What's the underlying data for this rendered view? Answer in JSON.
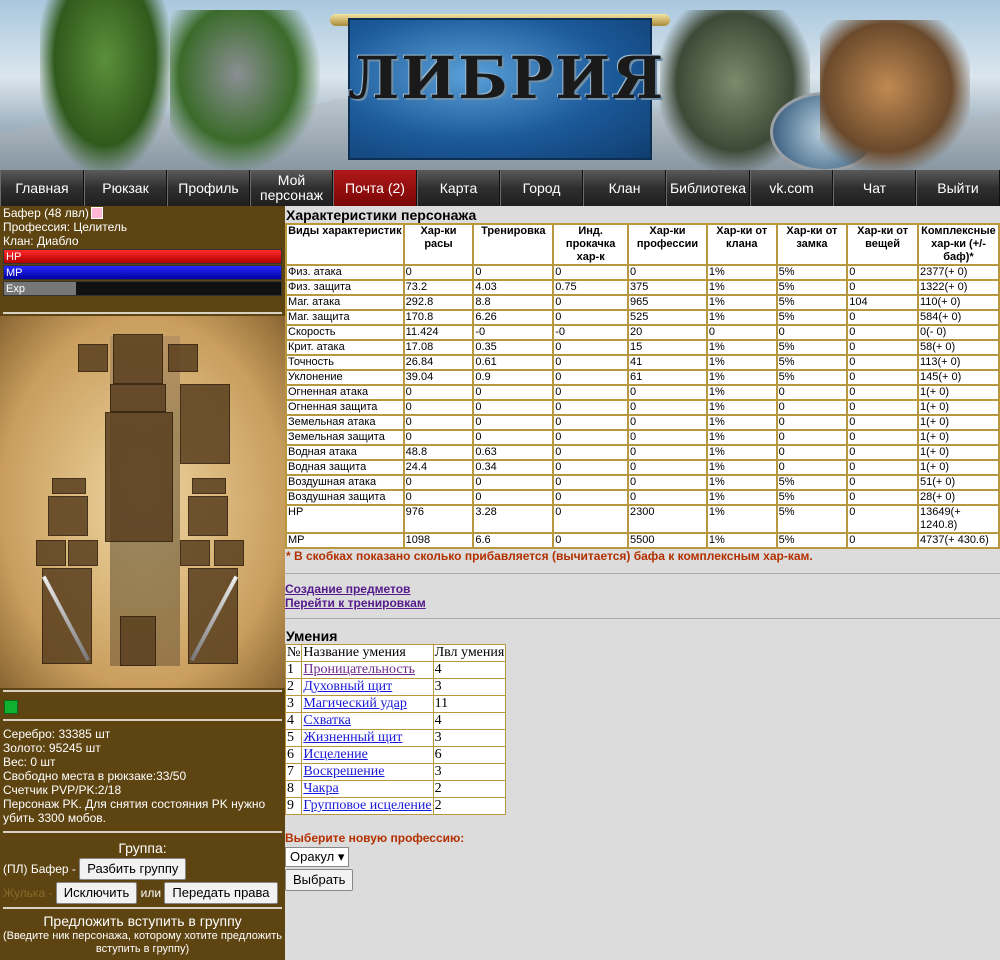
{
  "banner": {
    "logo_text": "ЛИБРИЯ"
  },
  "nav": {
    "items": [
      {
        "label": "Главная"
      },
      {
        "label": "Рюкзак"
      },
      {
        "label": "Профиль"
      },
      {
        "label": "Мой персонаж"
      },
      {
        "label": "Почта (2)",
        "active": true
      },
      {
        "label": "Карта"
      },
      {
        "label": "Город"
      },
      {
        "label": "Клан"
      },
      {
        "label": "Библиотека"
      },
      {
        "label": "vk.com"
      },
      {
        "label": "Чат"
      },
      {
        "label": "Выйти"
      }
    ]
  },
  "sidebar": {
    "name": "Бафер (48 лвл)",
    "profession": "Профессия: Целитель",
    "clan": "Клан: Диабло",
    "hp_label": "HP",
    "mp_label": "MP",
    "exp_label": "Exp",
    "hp_fraction": 1.0,
    "mp_fraction": 1.0,
    "exp_fraction": 0.26,
    "stats": [
      "Серебро: 33385 шт",
      "Золото: 95245 шт",
      "Вес: 0 шт",
      "Свободно места в рюкзаке:33/50",
      "Счетчик PVP/PK:2/18",
      "Персонаж PK. Для снятия состояния PK нужно убить 3300 мобов."
    ],
    "group_title": "Группа:",
    "group_leader": "(ПЛ) Бафер -",
    "split_button": "Разбить группу",
    "member_name": "Жулька -",
    "kick_button": "Исключить",
    "or_text": "или",
    "transfer_button": "Передать права",
    "invite_title": "Предложить вступить в группу",
    "invite_hint": "(Введите ник персонажа, которому хотите предложить вступить в группу)"
  },
  "stats": {
    "title": "Характеристики персонажа",
    "headers": [
      "Виды характеристик",
      "Хар-ки расы",
      "Тренировка",
      "Инд. прокачка хар-к",
      "Хар-ки профессии",
      "Хар-ки от клана",
      "Хар-ки от замка",
      "Хар-ки от вещей",
      "Комплексные хар-ки (+/- баф)*"
    ],
    "rows": [
      [
        "Физ. атака",
        "0",
        "0",
        "0",
        "0",
        "1%",
        "5%",
        "0",
        "2377(+ 0)"
      ],
      [
        "Физ. защита",
        "73.2",
        "4.03",
        "0.75",
        "375",
        "1%",
        "5%",
        "0",
        "1322(+ 0)"
      ],
      [
        "Маг. атака",
        "292.8",
        "8.8",
        "0",
        "965",
        "1%",
        "5%",
        "104",
        "110(+ 0)"
      ],
      [
        "Маг. защита",
        "170.8",
        "6.26",
        "0",
        "525",
        "1%",
        "5%",
        "0",
        "584(+ 0)"
      ],
      [
        "Скорость",
        "11.424",
        "-0",
        "-0",
        "20",
        "0",
        "0",
        "0",
        "0(- 0)"
      ],
      [
        "Крит. атака",
        "17.08",
        "0.35",
        "0",
        "15",
        "1%",
        "5%",
        "0",
        "58(+ 0)"
      ],
      [
        "Точность",
        "26.84",
        "0.61",
        "0",
        "41",
        "1%",
        "5%",
        "0",
        "113(+ 0)"
      ],
      [
        "Уклонение",
        "39.04",
        "0.9",
        "0",
        "61",
        "1%",
        "5%",
        "0",
        "145(+ 0)"
      ],
      [
        "Огненная атака",
        "0",
        "0",
        "0",
        "0",
        "1%",
        "0",
        "0",
        "1(+ 0)"
      ],
      [
        "Огненная защита",
        "0",
        "0",
        "0",
        "0",
        "1%",
        "0",
        "0",
        "1(+ 0)"
      ],
      [
        "Земельная атака",
        "0",
        "0",
        "0",
        "0",
        "1%",
        "0",
        "0",
        "1(+ 0)"
      ],
      [
        "Земельная защита",
        "0",
        "0",
        "0",
        "0",
        "1%",
        "0",
        "0",
        "1(+ 0)"
      ],
      [
        "Водная атака",
        "48.8",
        "0.63",
        "0",
        "0",
        "1%",
        "0",
        "0",
        "1(+ 0)"
      ],
      [
        "Водная защита",
        "24.4",
        "0.34",
        "0",
        "0",
        "1%",
        "0",
        "0",
        "1(+ 0)"
      ],
      [
        "Воздушная атака",
        "0",
        "0",
        "0",
        "0",
        "1%",
        "5%",
        "0",
        "51(+ 0)"
      ],
      [
        "Воздушная защита",
        "0",
        "0",
        "0",
        "0",
        "1%",
        "5%",
        "0",
        "28(+ 0)"
      ],
      [
        "HP",
        "976",
        "3.28",
        "0",
        "2300",
        "1%",
        "5%",
        "0",
        "13649(+ 1240.8)"
      ],
      [
        "MP",
        "1098",
        "6.6",
        "0",
        "5500",
        "1%",
        "5%",
        "0",
        "4737(+ 430.6)"
      ]
    ],
    "footnote": "* В скобках показано сколько прибавляется (вычитается) бафа к комплексным хар-кам."
  },
  "links": {
    "create_items": "Создание предметов",
    "training": "Перейти к тренировкам"
  },
  "skills": {
    "title": "Умения",
    "headers": [
      "№",
      "Название умения",
      "Лвл умения"
    ],
    "rows": [
      [
        "1",
        "Проницательность",
        "4"
      ],
      [
        "2",
        "Духовный щит",
        "3"
      ],
      [
        "3",
        "Магический удар",
        "11"
      ],
      [
        "4",
        "Схватка",
        "4"
      ],
      [
        "5",
        "Жизненный щит",
        "3"
      ],
      [
        "6",
        "Исцеление",
        "6"
      ],
      [
        "7",
        "Воскрешение",
        "3"
      ],
      [
        "8",
        "Чакра",
        "2"
      ],
      [
        "9",
        "Групповое исцеление",
        "2"
      ]
    ]
  },
  "profession": {
    "label": "Выберите новую профессию:",
    "selected": "Оракул",
    "choose_button": "Выбрать"
  }
}
